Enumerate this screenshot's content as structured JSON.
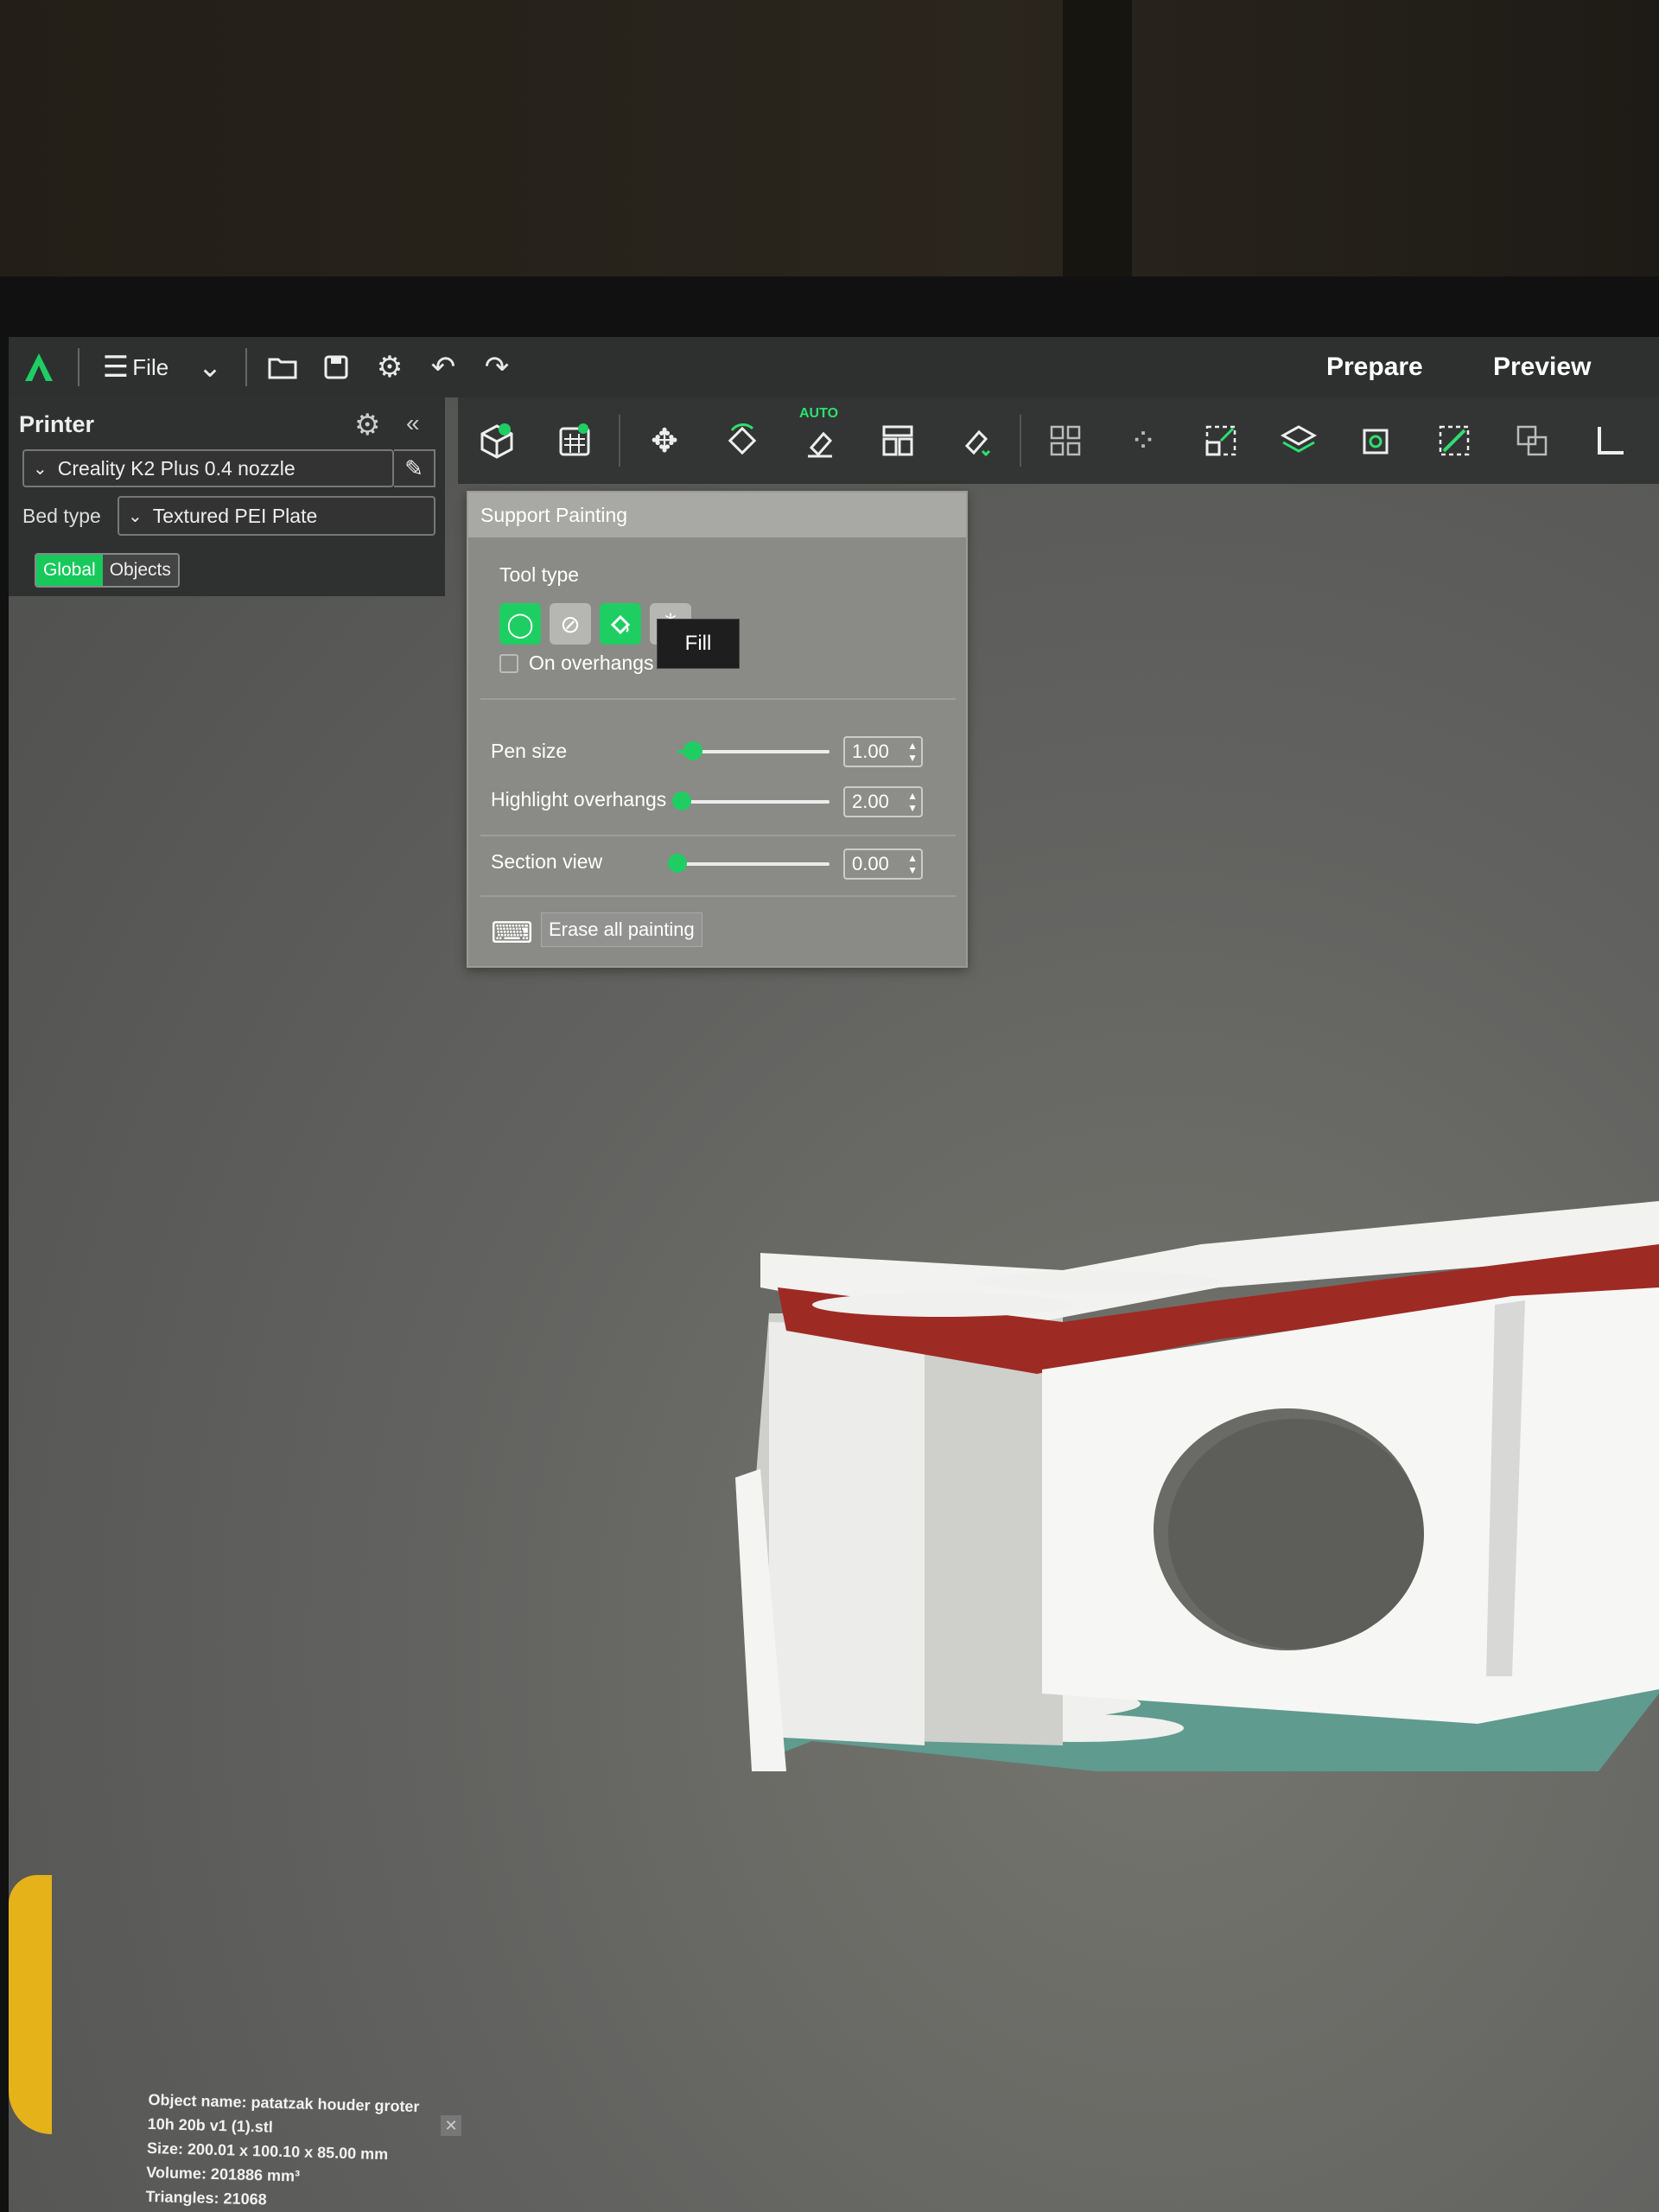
{
  "topbar": {
    "file_label": "File",
    "tab_prepare": "Prepare",
    "tab_preview": "Preview"
  },
  "left_panel": {
    "title": "Printer",
    "printer_value": "Creality K2 Plus 0.4 nozzle",
    "bed_type_label": "Bed type",
    "bed_type_value": "Textured PEI Plate",
    "seg_global": "Global",
    "seg_objects": "Objects"
  },
  "toolbar": {
    "auto_tag": "AUTO"
  },
  "support_painting": {
    "title": "Support Painting",
    "tool_type_label": "Tool type",
    "tooltip": "Fill",
    "on_overhangs_label": "On overhangs",
    "on_overhangs_checked": false,
    "pen_size_label": "Pen size",
    "pen_size_value": "1.00",
    "pen_size_fraction": 0.1,
    "highlight_label": "Highlight overhangs",
    "highlight_value": "2.00",
    "highlight_fraction": 0.03,
    "section_label": "Section view",
    "section_value": "0.00",
    "section_fraction": 0.0,
    "erase_label": "Erase all painting"
  },
  "object_info": {
    "name_line1": "Object name: patatzak houder groter",
    "name_line2": "10h 20b v1 (1).stl",
    "size": "Size: 200.01 x 100.10 x 85.00 mm",
    "volume": "Volume: 201886 mm³",
    "triangles": "Triangles: 21068"
  },
  "colors": {
    "accent": "#1fce62",
    "painted_support": "#9e2a24",
    "blocker": "#5f9b8e"
  }
}
